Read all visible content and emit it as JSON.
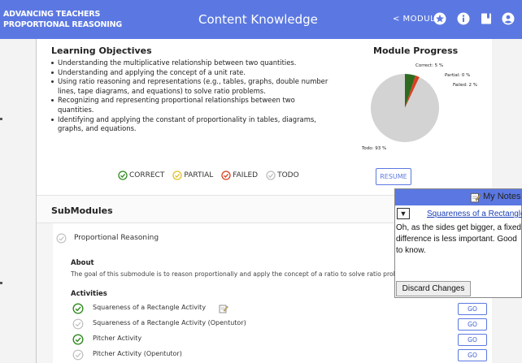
{
  "header": {
    "brand_line1": "ADVANCING TEACHERS",
    "brand_line2": "PROPORTIONAL REASONING",
    "title": "Content Knowledge",
    "modules_label": "< MODULES",
    "icons": [
      "star-icon",
      "info-icon",
      "bookmark-icon",
      "user-icon"
    ]
  },
  "objectives": {
    "title": "Learning Objectives",
    "items": [
      "Understanding the multiplicative relationship between two quantities.",
      "Understanding and applying the concept of a unit rate.",
      "Using ratio reasoning and representations (e.g., tables, graphs, double number lines, tape diagrams, and equations) to solve ratio problems.",
      "Recognizing and representing proportional relationships between two quantities.",
      "Identifying and applying the constant of proportionality in tables, diagrams, graphs, and equations."
    ]
  },
  "progress": {
    "title": "Module Progress",
    "slices": [
      {
        "label": "Correct: 5 %",
        "value": 5,
        "color": "#2e6b1f"
      },
      {
        "label": "Partial: 0 %",
        "value": 0,
        "color": "#e8c93a"
      },
      {
        "label": "Failed: 2 %",
        "value": 2,
        "color": "#d9401f"
      },
      {
        "label": "Todo: 93 %",
        "value": 93,
        "color": "#d3d3d3"
      }
    ]
  },
  "legend": {
    "correct": "CORRECT",
    "partial": "PARTIAL",
    "failed": "FAILED",
    "todo": "TODO"
  },
  "resume_label": "RESUME",
  "submodules": {
    "title": "SubModules",
    "item": "Proportional Reasoning",
    "about_heading": "About",
    "about_text": "The goal of this submodule is to reason proportionally and apply the concept of a ratio to solve ratio probl",
    "activities_heading": "Activities",
    "activities": [
      {
        "name": "Squareness of a Rectangle Activity",
        "status": "correct",
        "has_note": true,
        "go": "GO"
      },
      {
        "name": "Squareness of a Rectangle Activity (Opentutor)",
        "status": "todo",
        "has_note": false,
        "go": "GO"
      },
      {
        "name": "Pitcher Activity",
        "status": "correct",
        "has_note": false,
        "go": "GO"
      },
      {
        "name": "Pitcher Activity (Opentutor)",
        "status": "todo",
        "has_note": false,
        "go": "GO"
      }
    ]
  },
  "notes": {
    "title": "My Notes",
    "toggle": "▼",
    "link": "Squareness of a Rectangle",
    "text": "Oh, as the sides get bigger, a fixed difference is less important. Good to know.",
    "discard": "Discard Changes"
  },
  "colors": {
    "header": "#5b78e2",
    "correct": "#2f8a1f",
    "partial": "#e2c127",
    "failed": "#d9401f",
    "todo": "#bdbdbd"
  }
}
